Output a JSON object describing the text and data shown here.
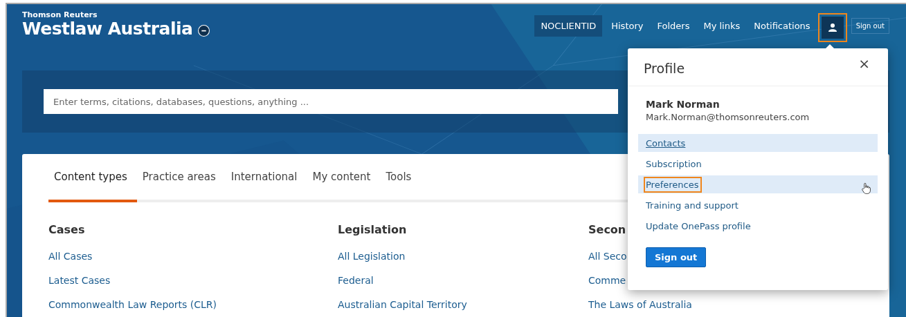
{
  "brand": {
    "company": "Thomson Reuters",
    "product": "Westlaw Australia"
  },
  "nav": {
    "client_id": "NOCLIENTID",
    "links": [
      "History",
      "Folders",
      "My links",
      "Notifications"
    ],
    "user_button_annotated": true,
    "sign_out": "Sign out"
  },
  "search": {
    "placeholder": "Enter terms, citations, databases, questions, anything ..."
  },
  "tabs": [
    {
      "label": "Content types",
      "selected": true
    },
    {
      "label": "Practice areas",
      "selected": false
    },
    {
      "label": "International",
      "selected": false
    },
    {
      "label": "My content",
      "selected": false
    },
    {
      "label": "Tools",
      "selected": false
    }
  ],
  "columns": [
    {
      "heading": "Cases",
      "links": [
        "All Cases",
        "Latest Cases",
        "Commonwealth Law Reports (CLR)"
      ]
    },
    {
      "heading": "Legislation",
      "links": [
        "All Legislation",
        "Federal",
        "Australian Capital Territory"
      ]
    },
    {
      "heading": "Secon",
      "links": [
        "All Seco",
        "Comme",
        "The Laws of Australia"
      ]
    }
  ],
  "profile": {
    "title": "Profile",
    "name": "Mark Norman",
    "email": "Mark.Norman@thomsonreuters.com",
    "items": [
      {
        "label": "Contacts",
        "highlighted": true,
        "underlined": true,
        "annotated": false
      },
      {
        "label": "Subscription",
        "highlighted": false,
        "underlined": false,
        "annotated": false
      },
      {
        "label": "Preferences",
        "highlighted": true,
        "underlined": false,
        "annotated": true
      },
      {
        "label": "Training and support",
        "highlighted": false,
        "underlined": false,
        "annotated": false
      },
      {
        "label": "Update OnePass profile",
        "highlighted": false,
        "underlined": false,
        "annotated": false
      }
    ],
    "sign_out": "Sign out",
    "close": "×"
  }
}
